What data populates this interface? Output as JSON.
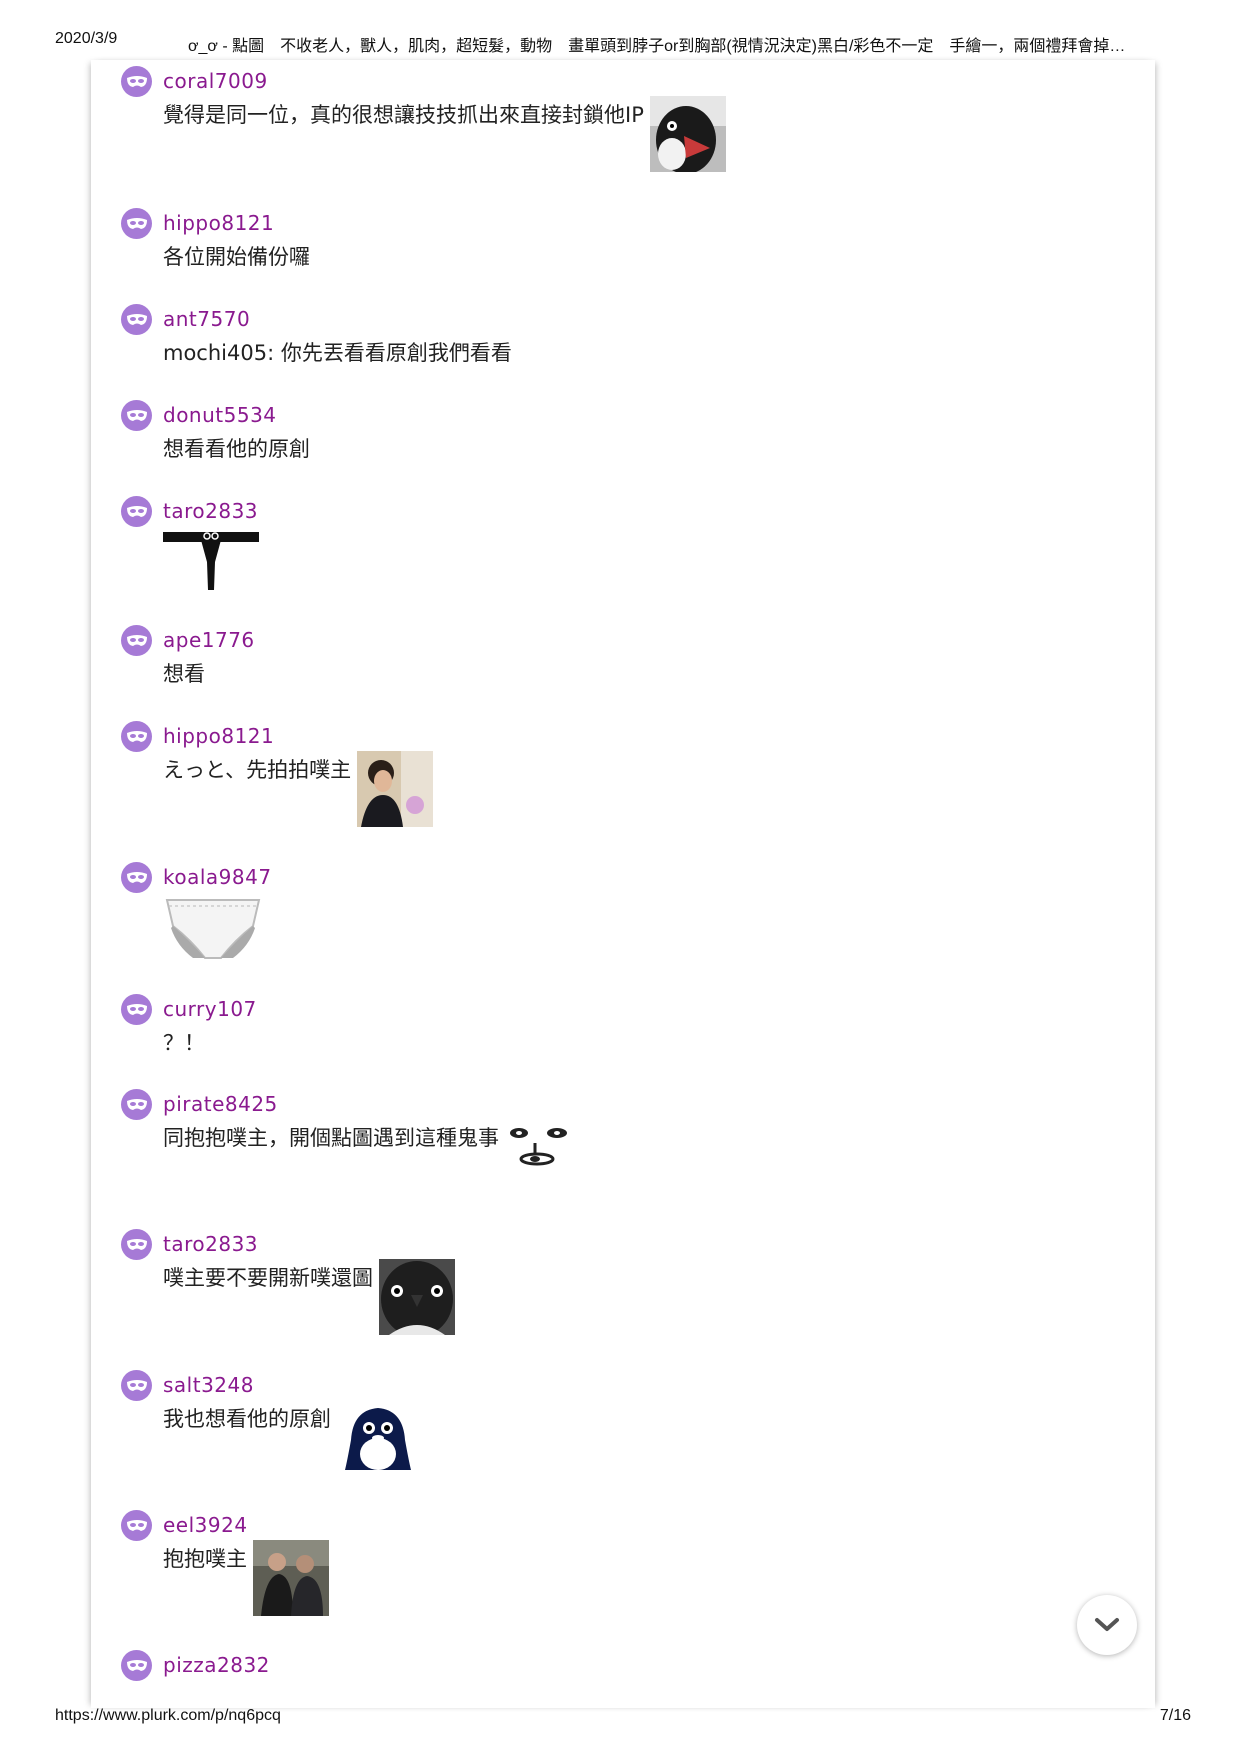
{
  "print_header": {
    "date": "2020/3/9",
    "title": "ơ_ơ - 點圖　不收老人，獸人，肌肉，超短髮，動物　畫單頭到脖子or到胸部(視情況決定)黑白/彩色不一定　手繪一，兩個禮拜會掉…"
  },
  "print_footer": {
    "url": "https://www.plurk.com/p/nq6pcq",
    "page": "7/16"
  },
  "responses": [
    {
      "user": "coral7009",
      "text": "覺得是同一位，真的很想讓技技抓出來直接封鎖他IP",
      "attachment": "penguin-screaming-photo"
    },
    {
      "user": "hippo8121",
      "text": "各位開始備份囉",
      "attachment": ""
    },
    {
      "user": "ant7570",
      "text": "mochi405: 你先丟看看原創我們看看",
      "attachment": ""
    },
    {
      "user": "donut5534",
      "text": "想看看他的原創",
      "attachment": ""
    },
    {
      "user": "taro2833",
      "text": "",
      "attachment": "black-thong-drawing"
    },
    {
      "user": "ape1776",
      "text": "想看",
      "attachment": ""
    },
    {
      "user": "hippo8121",
      "text": "えっと、先拍拍噗主",
      "attachment": "man-photo"
    },
    {
      "user": "koala9847",
      "text": "",
      "attachment": "white-briefs-drawing"
    },
    {
      "user": "curry107",
      "text": "？！",
      "attachment": ""
    },
    {
      "user": "pirate8425",
      "text": "同抱抱噗主，開個點圖遇到這種鬼事",
      "attachment": "shocked-face-doodle"
    },
    {
      "user": "taro2833",
      "text": "噗主要不要開新噗還圖",
      "attachment": "penguin-closeup-photo"
    },
    {
      "user": "salt3248",
      "text": "我也想看他的原創",
      "attachment": "penguin-cartoon"
    },
    {
      "user": "eel3924",
      "text": "抱抱噗主",
      "attachment": "two-men-photo"
    },
    {
      "user": "pizza2832",
      "text": "",
      "attachment": ""
    }
  ],
  "icons": {
    "avatar": "mask-icon",
    "scroll": "chevron-down-icon"
  },
  "colors": {
    "username": "#8a1a8f",
    "avatar_bg": "#a67ad6"
  }
}
